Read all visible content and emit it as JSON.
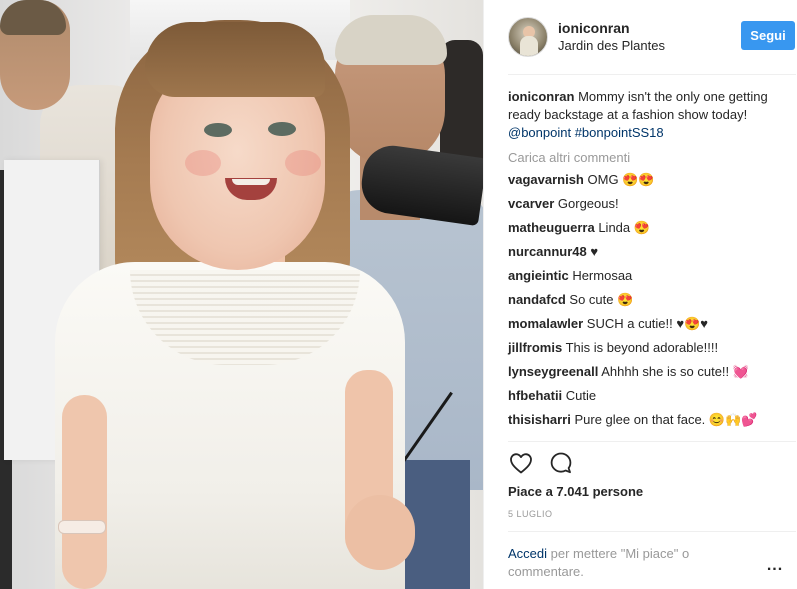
{
  "header": {
    "username": "ioniconran",
    "location": "Jardin des Plantes",
    "follow_label": "Segui",
    "follow_color": "#3897f0"
  },
  "caption": {
    "username": "ioniconran",
    "text": "Mommy isn't the only one getting ready backstage at a fashion show today!",
    "mention": "@bonpoint",
    "hashtag": "#bonpointSS18"
  },
  "load_more": "Carica altri commenti",
  "comments": [
    {
      "user": "vagavarnish",
      "text": "OMG 😍😍"
    },
    {
      "user": "vcarver",
      "text": "Gorgeous!"
    },
    {
      "user": "matheuguerra",
      "text": "Linda 😍"
    },
    {
      "user": "nurcannur48",
      "text": "♥"
    },
    {
      "user": "angieintic",
      "text": "Hermosaa"
    },
    {
      "user": "nandafcd",
      "text": "So cute 😍"
    },
    {
      "user": "momalawler",
      "text": "SUCH a cutie!! ♥😍♥"
    },
    {
      "user": "jillfromis",
      "text": "This is beyond adorable!!!!"
    },
    {
      "user": "lynseygreenall",
      "text": "Ahhhh she is so cute!! 💓"
    },
    {
      "user": "hfbehatii",
      "text": "Cutie"
    },
    {
      "user": "thisisharri",
      "text": "Pure glee on that face. 😊🙌💕"
    }
  ],
  "actions": {
    "like_icon": "heart-outline-icon",
    "comment_icon": "comment-bubble-icon"
  },
  "likes": "Piace a 7.041 persone",
  "date": "5 LUGLIO",
  "add_comment": {
    "link": "Accedi",
    "text": " per mettere \"Mi piace\" o commentare."
  },
  "more_label": "..."
}
